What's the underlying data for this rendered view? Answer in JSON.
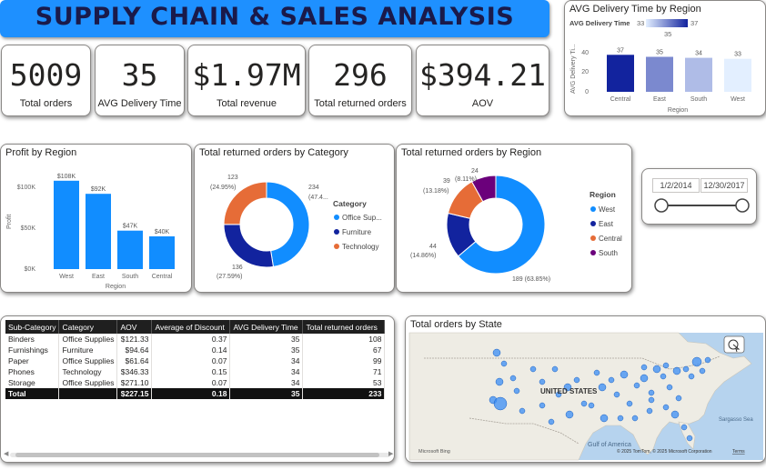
{
  "title": "SUPPLY CHAIN & SALES ANALYSIS",
  "kpis": [
    {
      "value": "5009",
      "label": "Total orders"
    },
    {
      "value": "35",
      "label": "AVG Delivery Time"
    },
    {
      "value": "$1.97M",
      "label": "Total revenue"
    },
    {
      "value": "296",
      "label": "Total returned orders"
    },
    {
      "value": "$394.21",
      "label": "AOV"
    }
  ],
  "delivery_chart": {
    "title": "AVG Delivery Time by Region",
    "legend_title": "AVG Delivery Time",
    "legend_min": "33",
    "legend_max": "37",
    "legend_mid": "35",
    "ylabel": "AVG Delivery Ti...",
    "xlabel": "Region",
    "tick_40": "40",
    "tick_20": "20",
    "tick_0": "0"
  },
  "profit_chart": {
    "title": "Profit by Region",
    "ylabel": "Profit",
    "xlabel": "Region",
    "tick_100": "$100K",
    "tick_50": "$50K",
    "tick_0": "$0K"
  },
  "category_donut": {
    "title": "Total returned orders by Category",
    "legend_title": "Category",
    "label_a_value": "234",
    "label_a_pct": "(47.4...",
    "label_b_value": "123",
    "label_b_pct": "(24.95%)",
    "label_c_value": "136",
    "label_c_pct": "(27.59%)"
  },
  "region_donut": {
    "title": "Total returned orders by Region",
    "legend_title": "Region",
    "label_west": "189 (63.85%)",
    "label_east_value": "44",
    "label_east_pct": "(14.86%)",
    "label_central_value": "39",
    "label_central_pct": "(13.18%)",
    "label_south_value": "24",
    "label_south_pct": "(8.11%)"
  },
  "slicer": {
    "start": "1/2/2014",
    "end": "12/30/2017"
  },
  "table": {
    "headers": [
      "Sub-Category",
      "Category",
      "AOV",
      "Average of Discount",
      "AVG Delivery Time",
      "Total returned orders"
    ],
    "rows": [
      [
        "Binders",
        "Office Supplies",
        "$121.33",
        "0.37",
        "35",
        "108"
      ],
      [
        "Furnishings",
        "Furniture",
        "$94.64",
        "0.14",
        "35",
        "67"
      ],
      [
        "Paper",
        "Office Supplies",
        "$61.64",
        "0.07",
        "34",
        "99"
      ],
      [
        "Phones",
        "Technology",
        "$346.33",
        "0.15",
        "34",
        "71"
      ],
      [
        "Storage",
        "Office Supplies",
        "$271.10",
        "0.07",
        "34",
        "53"
      ]
    ],
    "total": [
      "Total",
      "",
      "$227.15",
      "0.18",
      "35",
      "233"
    ]
  },
  "map": {
    "title": "Total orders by State",
    "country_label": "UNITED STATES",
    "sea_label_1": "Sargasso Sea",
    "sea_label_2": "Gulf of America",
    "bing_label": "Microsoft Bing",
    "copyright": "© 2025 TomTom, © 2025 Microsoft Corporation",
    "terms": "Terms"
  },
  "colors": {
    "accent": "#1e90ff",
    "bar": "#118dff",
    "dark_blue": "#12239e",
    "orange": "#e66c37",
    "purple": "#6b007b",
    "map_water": "#b6d3ee",
    "map_land": "#eeece4"
  },
  "chart_data": [
    {
      "type": "bar",
      "title": "AVG Delivery Time by Region",
      "categories": [
        "Central",
        "East",
        "South",
        "West"
      ],
      "values": [
        37,
        35,
        34,
        33
      ],
      "xlabel": "Region",
      "ylabel": "AVG Delivery Ti...",
      "ylim": [
        0,
        40
      ]
    },
    {
      "type": "bar",
      "title": "Profit by Region",
      "categories": [
        "West",
        "East",
        "South",
        "Central"
      ],
      "values": [
        108000,
        92000,
        47000,
        40000
      ],
      "value_labels": [
        "$108K",
        "$92K",
        "$47K",
        "$40K"
      ],
      "xlabel": "Region",
      "ylabel": "Profit",
      "ylim": [
        0,
        110000
      ]
    },
    {
      "type": "pie",
      "title": "Total returned orders by Category",
      "categories": [
        "Office Sup...",
        "Furniture",
        "Technology"
      ],
      "values": [
        234,
        136,
        123
      ],
      "colors": [
        "#118dff",
        "#12239e",
        "#e66c37"
      ]
    },
    {
      "type": "pie",
      "title": "Total returned orders by Region",
      "categories": [
        "West",
        "East",
        "Central",
        "South"
      ],
      "values": [
        189,
        44,
        39,
        24
      ],
      "colors": [
        "#118dff",
        "#12239e",
        "#e66c37",
        "#6b007b"
      ]
    }
  ]
}
